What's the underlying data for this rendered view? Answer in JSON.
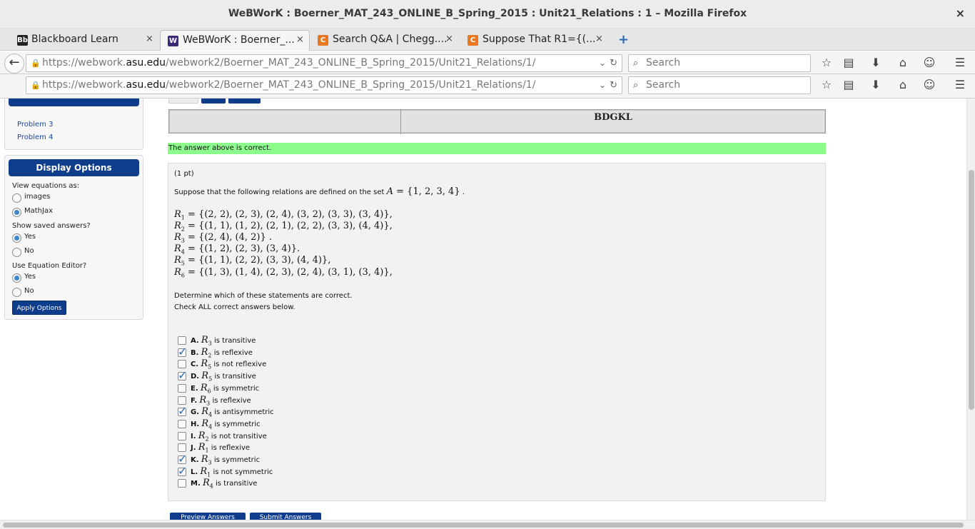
{
  "window": {
    "title": "WeBWorK : Boerner_MAT_243_ONLINE_B_Spring_2015 : Unit21_Relations : 1 – Mozilla Firefox",
    "close": "×"
  },
  "tabs": [
    {
      "label": "Blackboard Learn",
      "favicon": "Bb",
      "favicon_color": "#222222"
    },
    {
      "label": "WeBWorK : Boerner_...",
      "favicon": "W",
      "favicon_color": "#3b2a7a"
    },
    {
      "label": "Search Q&A | Chegg....",
      "favicon": "C",
      "favicon_color": "#e87722"
    },
    {
      "label": "Suppose That R1={(...",
      "favicon": "C",
      "favicon_color": "#e87722"
    }
  ],
  "tab_close": "×",
  "newtab": "+",
  "url": {
    "prefix": "https://webwork.",
    "domain": "asu.edu",
    "suffix": "/webwork2/Boerner_MAT_243_ONLINE_B_Spring_2015/Unit21_Relations/1/"
  },
  "search_placeholder": "Search",
  "sidebar": {
    "problem_links": [
      "Problem 3",
      "Problem 4"
    ],
    "display_options_title": "Display Options",
    "view_equations_label": "View equations as:",
    "view_options": [
      "images",
      "MathJax"
    ],
    "saved_answers_label": "Show saved answers?",
    "equation_editor_label": "Use Equation Editor?",
    "yes": "Yes",
    "no": "No",
    "apply_label": "Apply Options"
  },
  "result_table": {
    "value": "BDGKL"
  },
  "correct_message": "The answer above is correct.",
  "problem": {
    "points": "(1 pt)",
    "intro": "Suppose that the following relations are defined on the set",
    "set_expr": "{1, 2, 3, 4}",
    "relations": [
      {
        "sub": "1",
        "expr": "{(2, 2), (2, 3), (2, 4), (3, 2), (3, 3), (3, 4)},",
        "tail": ""
      },
      {
        "sub": "2",
        "expr": "{(1, 1), (1, 2), (2, 1), (2, 2), (3, 3), (4, 4)},",
        "tail": ""
      },
      {
        "sub": "3",
        "expr": "{(2, 4), (4, 2)}",
        "tail": " ."
      },
      {
        "sub": "4",
        "expr": "{(1, 2), (2, 3), (3, 4)}",
        "tail": "."
      },
      {
        "sub": "5",
        "expr": "{(1, 1), (2, 2), (3, 3), (4, 4)},",
        "tail": ""
      },
      {
        "sub": "6",
        "expr": "{(1, 3), (1, 4), (2, 3), (2, 4), (3, 1), (3, 4)},",
        "tail": ""
      }
    ],
    "determine": "Determine which of these statements are correct.",
    "check_all": "Check ALL correct answers below.",
    "answers": [
      {
        "letter": "A.",
        "sub": "3",
        "text": "is transitive",
        "checked": false
      },
      {
        "letter": "B.",
        "sub": "2",
        "text": "is reflexive",
        "checked": true
      },
      {
        "letter": "C.",
        "sub": "5",
        "text": "is not reflexive",
        "checked": false
      },
      {
        "letter": "D.",
        "sub": "5",
        "text": "is transitive",
        "checked": true
      },
      {
        "letter": "E.",
        "sub": "6",
        "text": "is symmetric",
        "checked": false
      },
      {
        "letter": "F.",
        "sub": "3",
        "text": "is reflexive",
        "checked": false
      },
      {
        "letter": "G.",
        "sub": "4",
        "text": "is antisymmetric",
        "checked": true
      },
      {
        "letter": "H.",
        "sub": "4",
        "text": "is symmetric",
        "checked": false
      },
      {
        "letter": "I.",
        "sub": "2",
        "text": "is not transitive",
        "checked": false
      },
      {
        "letter": "J.",
        "sub": "1",
        "text": "is reflexive",
        "checked": false
      },
      {
        "letter": "K.",
        "sub": "3",
        "text": "is symmetric",
        "checked": true
      },
      {
        "letter": "L.",
        "sub": "1",
        "text": "is not symmetric",
        "checked": true
      },
      {
        "letter": "M.",
        "sub": "4",
        "text": "is transitive",
        "checked": false
      }
    ]
  },
  "bottom_buttons": [
    "Preview Answers",
    "Submit Answers"
  ]
}
